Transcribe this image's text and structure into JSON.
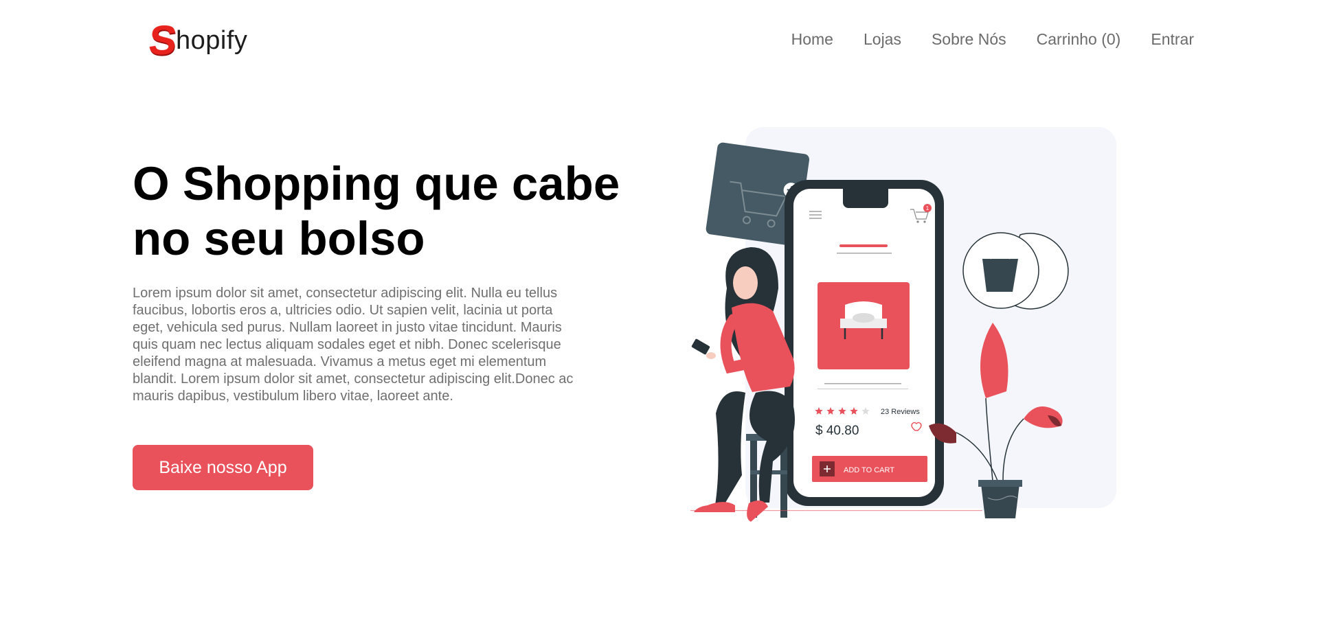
{
  "brand": {
    "logo_letter": "S",
    "logo_rest": "hopify"
  },
  "nav": {
    "items": [
      "Home",
      "Lojas",
      "Sobre Nós",
      "Carrinho (0)",
      "Entrar"
    ]
  },
  "hero": {
    "title_bold": "O Shopping",
    "title_rest": " que cabe no seu bolso",
    "text": "Lorem ipsum dolor sit amet, consectetur adipiscing elit. Nulla eu tellus faucibus, lobortis eros a, ultricies odio. Ut sapien velit, lacinia ut porta eget, vehicula sed purus. Nullam laoreet in justo vitae tincidunt. Mauris quis quam nec lectus aliquam sodales eget et nibh. Donec scelerisque eleifend magna at malesuada. Vivamus a metus eget mi elementum blandit. Lorem ipsum dolor sit amet, consectetur adipiscing elit.Donec ac mauris dapibus, vestibulum libero vitae, laoreet ante.",
    "cta_label": "Baixe nosso App"
  },
  "illustration": {
    "cart_badge": "1",
    "reviews": "23 Reviews",
    "rating": 4,
    "rating_max": 5,
    "price": "$ 40.80",
    "add_to_cart": "ADD TO CART"
  },
  "colors": {
    "accent": "#e9525b",
    "dark": "#263238",
    "panel": "#f4f6fb"
  }
}
